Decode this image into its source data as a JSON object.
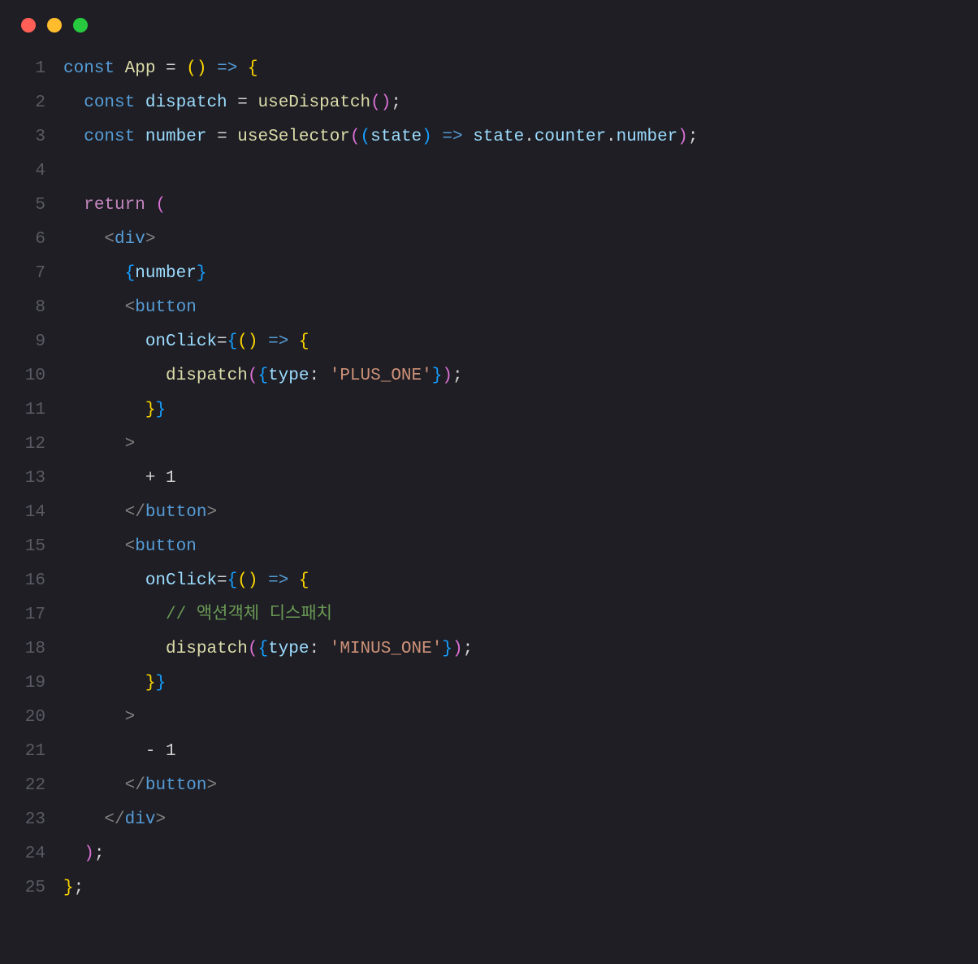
{
  "titlebar": {
    "dots": [
      "red",
      "yellow",
      "green"
    ]
  },
  "lineNumbers": [
    "1",
    "2",
    "3",
    "4",
    "5",
    "6",
    "7",
    "8",
    "9",
    "10",
    "11",
    "12",
    "13",
    "14",
    "15",
    "16",
    "17",
    "18",
    "19",
    "20",
    "21",
    "22",
    "23",
    "24",
    "25"
  ],
  "code": {
    "lines": [
      [
        {
          "t": "const ",
          "c": "kw"
        },
        {
          "t": "App",
          "c": "fn"
        },
        {
          "t": " ",
          "c": "op"
        },
        {
          "t": "=",
          "c": "op"
        },
        {
          "t": " ",
          "c": "op"
        },
        {
          "t": "(",
          "c": "brace"
        },
        {
          "t": ")",
          "c": "brace"
        },
        {
          "t": " ",
          "c": "op"
        },
        {
          "t": "=>",
          "c": "arrow"
        },
        {
          "t": " ",
          "c": "op"
        },
        {
          "t": "{",
          "c": "brace"
        }
      ],
      [
        {
          "t": "  ",
          "c": "op"
        },
        {
          "t": "const ",
          "c": "kw"
        },
        {
          "t": "dispatch",
          "c": "var"
        },
        {
          "t": " ",
          "c": "op"
        },
        {
          "t": "=",
          "c": "op"
        },
        {
          "t": " ",
          "c": "op"
        },
        {
          "t": "useDispatch",
          "c": "fn"
        },
        {
          "t": "(",
          "c": "brace2"
        },
        {
          "t": ")",
          "c": "brace2"
        },
        {
          "t": ";",
          "c": "op"
        }
      ],
      [
        {
          "t": "  ",
          "c": "op"
        },
        {
          "t": "const ",
          "c": "kw"
        },
        {
          "t": "number",
          "c": "var"
        },
        {
          "t": " ",
          "c": "op"
        },
        {
          "t": "=",
          "c": "op"
        },
        {
          "t": " ",
          "c": "op"
        },
        {
          "t": "useSelector",
          "c": "fn"
        },
        {
          "t": "(",
          "c": "brace2"
        },
        {
          "t": "(",
          "c": "brace3"
        },
        {
          "t": "state",
          "c": "var"
        },
        {
          "t": ")",
          "c": "brace3"
        },
        {
          "t": " ",
          "c": "op"
        },
        {
          "t": "=>",
          "c": "arrow"
        },
        {
          "t": " ",
          "c": "op"
        },
        {
          "t": "state",
          "c": "var"
        },
        {
          "t": ".",
          "c": "op"
        },
        {
          "t": "counter",
          "c": "var"
        },
        {
          "t": ".",
          "c": "op"
        },
        {
          "t": "number",
          "c": "var"
        },
        {
          "t": ")",
          "c": "brace2"
        },
        {
          "t": ";",
          "c": "op"
        }
      ],
      [
        {
          "t": "",
          "c": "op"
        }
      ],
      [
        {
          "t": "  ",
          "c": "op"
        },
        {
          "t": "return",
          "c": "ret"
        },
        {
          "t": " ",
          "c": "op"
        },
        {
          "t": "(",
          "c": "brace2"
        }
      ],
      [
        {
          "t": "    ",
          "c": "op"
        },
        {
          "t": "<",
          "c": "tag"
        },
        {
          "t": "div",
          "c": "tagname"
        },
        {
          "t": ">",
          "c": "tag"
        }
      ],
      [
        {
          "t": "      ",
          "c": "op"
        },
        {
          "t": "{",
          "c": "brace3"
        },
        {
          "t": "number",
          "c": "var"
        },
        {
          "t": "}",
          "c": "brace3"
        }
      ],
      [
        {
          "t": "      ",
          "c": "op"
        },
        {
          "t": "<",
          "c": "tag"
        },
        {
          "t": "button",
          "c": "tagname"
        }
      ],
      [
        {
          "t": "        ",
          "c": "op"
        },
        {
          "t": "onClick",
          "c": "attr"
        },
        {
          "t": "=",
          "c": "op"
        },
        {
          "t": "{",
          "c": "brace3"
        },
        {
          "t": "(",
          "c": "brace"
        },
        {
          "t": ")",
          "c": "brace"
        },
        {
          "t": " ",
          "c": "op"
        },
        {
          "t": "=>",
          "c": "arrow"
        },
        {
          "t": " ",
          "c": "op"
        },
        {
          "t": "{",
          "c": "brace"
        }
      ],
      [
        {
          "t": "          ",
          "c": "op"
        },
        {
          "t": "dispatch",
          "c": "fn"
        },
        {
          "t": "(",
          "c": "brace2"
        },
        {
          "t": "{",
          "c": "brace3"
        },
        {
          "t": "type",
          "c": "var"
        },
        {
          "t": ":",
          "c": "op"
        },
        {
          "t": " ",
          "c": "op"
        },
        {
          "t": "'PLUS_ONE'",
          "c": "str"
        },
        {
          "t": "}",
          "c": "brace3"
        },
        {
          "t": ")",
          "c": "brace2"
        },
        {
          "t": ";",
          "c": "op"
        }
      ],
      [
        {
          "t": "        ",
          "c": "op"
        },
        {
          "t": "}",
          "c": "brace"
        },
        {
          "t": "}",
          "c": "brace3"
        }
      ],
      [
        {
          "t": "      ",
          "c": "op"
        },
        {
          "t": ">",
          "c": "tag"
        }
      ],
      [
        {
          "t": "        ",
          "c": "op"
        },
        {
          "t": "+ 1",
          "c": "txt"
        }
      ],
      [
        {
          "t": "      ",
          "c": "op"
        },
        {
          "t": "</",
          "c": "tag"
        },
        {
          "t": "button",
          "c": "tagname"
        },
        {
          "t": ">",
          "c": "tag"
        }
      ],
      [
        {
          "t": "      ",
          "c": "op"
        },
        {
          "t": "<",
          "c": "tag"
        },
        {
          "t": "button",
          "c": "tagname"
        }
      ],
      [
        {
          "t": "        ",
          "c": "op"
        },
        {
          "t": "onClick",
          "c": "attr"
        },
        {
          "t": "=",
          "c": "op"
        },
        {
          "t": "{",
          "c": "brace3"
        },
        {
          "t": "(",
          "c": "brace"
        },
        {
          "t": ")",
          "c": "brace"
        },
        {
          "t": " ",
          "c": "op"
        },
        {
          "t": "=>",
          "c": "arrow"
        },
        {
          "t": " ",
          "c": "op"
        },
        {
          "t": "{",
          "c": "brace"
        }
      ],
      [
        {
          "t": "          ",
          "c": "op"
        },
        {
          "t": "// 액션객체 디스패치",
          "c": "cmt"
        }
      ],
      [
        {
          "t": "          ",
          "c": "op"
        },
        {
          "t": "dispatch",
          "c": "fn"
        },
        {
          "t": "(",
          "c": "brace2"
        },
        {
          "t": "{",
          "c": "brace3"
        },
        {
          "t": "type",
          "c": "var"
        },
        {
          "t": ":",
          "c": "op"
        },
        {
          "t": " ",
          "c": "op"
        },
        {
          "t": "'MINUS_ONE'",
          "c": "str"
        },
        {
          "t": "}",
          "c": "brace3"
        },
        {
          "t": ")",
          "c": "brace2"
        },
        {
          "t": ";",
          "c": "op"
        }
      ],
      [
        {
          "t": "        ",
          "c": "op"
        },
        {
          "t": "}",
          "c": "brace"
        },
        {
          "t": "}",
          "c": "brace3"
        }
      ],
      [
        {
          "t": "      ",
          "c": "op"
        },
        {
          "t": ">",
          "c": "tag"
        }
      ],
      [
        {
          "t": "        ",
          "c": "op"
        },
        {
          "t": "- 1",
          "c": "txt"
        }
      ],
      [
        {
          "t": "      ",
          "c": "op"
        },
        {
          "t": "</",
          "c": "tag"
        },
        {
          "t": "button",
          "c": "tagname"
        },
        {
          "t": ">",
          "c": "tag"
        }
      ],
      [
        {
          "t": "    ",
          "c": "op"
        },
        {
          "t": "</",
          "c": "tag"
        },
        {
          "t": "div",
          "c": "tagname"
        },
        {
          "t": ">",
          "c": "tag"
        }
      ],
      [
        {
          "t": "  ",
          "c": "op"
        },
        {
          "t": ")",
          "c": "brace2"
        },
        {
          "t": ";",
          "c": "op"
        }
      ],
      [
        {
          "t": "}",
          "c": "brace"
        },
        {
          "t": ";",
          "c": "op"
        }
      ]
    ]
  }
}
